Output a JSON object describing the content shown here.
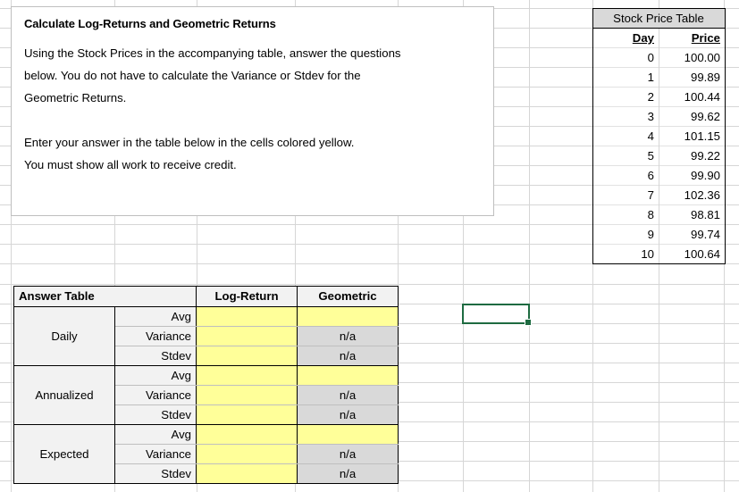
{
  "instructions": {
    "title": "Calculate Log-Returns and Geometric Returns",
    "paragraph1_line1": "Using the Stock Prices in the accompanying table, answer the questions",
    "paragraph1_line2": "below. You do not have to calculate the Variance or Stdev for the",
    "paragraph1_line3": "Geometric Returns.",
    "paragraph2_line1": "Enter your answer in the table below in the cells colored yellow.",
    "paragraph2_line2": "You must show all work to receive credit."
  },
  "stock_price_table": {
    "title": "Stock Price Table",
    "columns": [
      "Day",
      "Price"
    ],
    "rows": [
      {
        "day": "0",
        "price": "100.00"
      },
      {
        "day": "1",
        "price": "99.89"
      },
      {
        "day": "2",
        "price": "100.44"
      },
      {
        "day": "3",
        "price": "99.62"
      },
      {
        "day": "4",
        "price": "101.15"
      },
      {
        "day": "5",
        "price": "99.22"
      },
      {
        "day": "6",
        "price": "99.90"
      },
      {
        "day": "7",
        "price": "102.36"
      },
      {
        "day": "8",
        "price": "98.81"
      },
      {
        "day": "9",
        "price": "99.74"
      },
      {
        "day": "10",
        "price": "100.64"
      }
    ]
  },
  "answer_table": {
    "title": "Answer Table",
    "columns": [
      "Log-Return",
      "Geometric"
    ],
    "na_text": "n/a",
    "groups": [
      {
        "label": "Daily",
        "rows": [
          {
            "stat": "Avg",
            "log_return": "",
            "geometric": ""
          },
          {
            "stat": "Variance",
            "log_return": "",
            "geometric": "n/a"
          },
          {
            "stat": "Stdev",
            "log_return": "",
            "geometric": "n/a"
          }
        ]
      },
      {
        "label": "Annualized",
        "rows": [
          {
            "stat": "Avg",
            "log_return": "",
            "geometric": ""
          },
          {
            "stat": "Variance",
            "log_return": "",
            "geometric": "n/a"
          },
          {
            "stat": "Stdev",
            "log_return": "",
            "geometric": "n/a"
          }
        ]
      },
      {
        "label": "Expected",
        "rows": [
          {
            "stat": "Avg",
            "log_return": "",
            "geometric": ""
          },
          {
            "stat": "Variance",
            "log_return": "",
            "geometric": "n/a"
          },
          {
            "stat": "Stdev",
            "log_return": "",
            "geometric": "n/a"
          }
        ]
      }
    ]
  },
  "colors": {
    "input_cell": "#FFFF99",
    "disabled_cell": "#D9D9D9",
    "header_cell": "#F2F2F2",
    "selection_border": "#1E6B41",
    "gridline": "#D6D6D6"
  }
}
